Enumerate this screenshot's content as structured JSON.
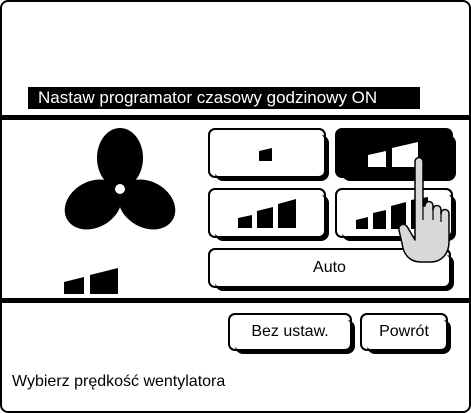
{
  "header": {
    "title": "Nastaw programator czasowy godzinowy ON"
  },
  "fan_icon": "fan-icon",
  "current_speed_level": 2,
  "speed_levels": [
    {
      "label": "fan-speed-1",
      "level": 1,
      "selected": false
    },
    {
      "label": "fan-speed-2",
      "level": 2,
      "selected": true
    },
    {
      "label": "fan-speed-3",
      "level": 3,
      "selected": false
    },
    {
      "label": "fan-speed-4",
      "level": 4,
      "selected": false
    }
  ],
  "buttons": {
    "auto": "Auto",
    "no_setting": "Bez ustaw.",
    "back": "Powrót"
  },
  "status": {
    "hint": "Wybierz prędkość wentylatora"
  },
  "pointer_icon": "pointing-hand-icon"
}
